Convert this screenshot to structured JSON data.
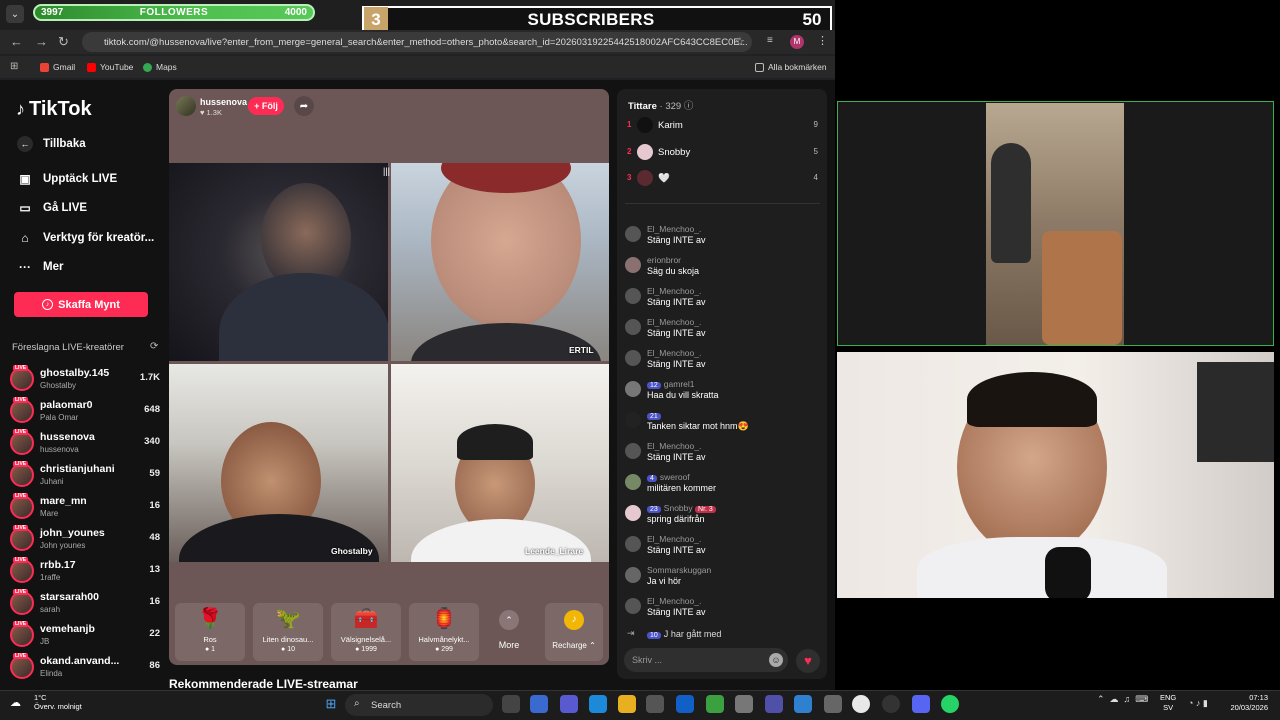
{
  "overlay": {
    "followers": {
      "min": "3997",
      "label": "FOLLOWERS",
      "max": "4000",
      "progress": 0.99
    },
    "subscribers": {
      "rank": "3",
      "label": "SUBSCRIBERS",
      "count": "50"
    }
  },
  "browser": {
    "url": "tiktok.com/@hussenova/live?enter_from_merge=general_search&enter_method=others_photo&search_id=20260319225442518002AFC643CC8EC0E...",
    "bookmarks": [
      "Gmail",
      "YouTube",
      "Maps"
    ],
    "all_bookmarks": "Alla bokmärken",
    "profile_initial": "M"
  },
  "sidebar": {
    "logo": "TikTok",
    "back": "Tillbaka",
    "nav": [
      {
        "label": "Upptäck LIVE",
        "icon": "calendar-icon"
      },
      {
        "label": "Gå LIVE",
        "icon": "camera-icon"
      },
      {
        "label": "Verktyg för kreatör...",
        "icon": "home-icon"
      },
      {
        "label": "Mer",
        "icon": "more-icon"
      }
    ],
    "coins_button": "Skaffa Mynt",
    "suggested_title": "Föreslagna LIVE-kreatörer",
    "creators": [
      {
        "name": "ghostalby.145",
        "sub": "Ghostalby",
        "viewers": "1.7K"
      },
      {
        "name": "palaomar0",
        "sub": "Pala Omar",
        "viewers": "648"
      },
      {
        "name": "hussenova",
        "sub": "hussenova",
        "viewers": "340"
      },
      {
        "name": "christianjuhani",
        "sub": "Juhani",
        "viewers": "59"
      },
      {
        "name": "mare_mn",
        "sub": "Mare",
        "viewers": "16"
      },
      {
        "name": "john_younes",
        "sub": "John younes",
        "viewers": "48"
      },
      {
        "name": "rrbb.17",
        "sub": "1raffe",
        "viewers": "13"
      },
      {
        "name": "starsarah00",
        "sub": "sarah",
        "viewers": "16"
      },
      {
        "name": "vemehanjb",
        "sub": "JB",
        "viewers": "22"
      },
      {
        "name": "okand.anvand...",
        "sub": "Elinda",
        "viewers": "86"
      }
    ],
    "live_badge": "LIVE"
  },
  "player": {
    "host": "hussenova",
    "likes": "1.3K",
    "follow": "+ Följ",
    "cam_tags": {
      "cam2": "ERTIL",
      "cam3": "Ghostalby",
      "cam4": "Leende_Lirare"
    },
    "gifts": [
      {
        "name": "Ros",
        "price": "1",
        "icon": "rose-icon"
      },
      {
        "name": "Liten dinosau...",
        "price": "10",
        "icon": "dinosaur-icon"
      },
      {
        "name": "Välsignelselå...",
        "price": "1999",
        "icon": "chest-icon"
      },
      {
        "name": "Halvmånelykt...",
        "price": "299",
        "icon": "lantern-icon"
      }
    ],
    "more": "More",
    "recharge": "Recharge",
    "recommended": "Rekommenderade LIVE-streamar"
  },
  "chat": {
    "viewers_label": "Tittare",
    "viewers_count": "· 329",
    "top": [
      {
        "rank": "1",
        "name": "Karim",
        "score": "9"
      },
      {
        "rank": "2",
        "name": "Snobby",
        "score": "5"
      },
      {
        "rank": "3",
        "name": "🤍",
        "score": "4"
      }
    ],
    "messages": [
      {
        "user": "El_Menchoo_.",
        "text": "Stäng INTE av",
        "badge": ""
      },
      {
        "user": "erionbror",
        "text": "Säg du skoja",
        "badge": ""
      },
      {
        "user": "El_Menchoo_.",
        "text": "Stäng INTE av",
        "badge": ""
      },
      {
        "user": "El_Menchoo_.",
        "text": "Stäng INTE av",
        "badge": ""
      },
      {
        "user": "El_Menchoo_.",
        "text": "Stäng INTE av",
        "badge": ""
      },
      {
        "user": "gamrel1",
        "text": "Haa du vill skratta",
        "badge": "12"
      },
      {
        "user": "",
        "text": "Tanken siktar mot hnm😍",
        "badge": "21"
      },
      {
        "user": "El_Menchoo_.",
        "text": "Stäng INTE av",
        "badge": ""
      },
      {
        "user": "sweroof",
        "text": "militären kommer",
        "badge": "4"
      },
      {
        "user": "Snobby",
        "text": "spring därifrån",
        "badge": "23",
        "extra": "Nr. 3"
      },
      {
        "user": "El_Menchoo_.",
        "text": "Stäng INTE av",
        "badge": ""
      },
      {
        "user": "Sommarskuggan",
        "text": "Ja vi hör",
        "badge": ""
      },
      {
        "user": "El_Menchoo_.",
        "text": "Stäng INTE av",
        "badge": ""
      }
    ],
    "join": {
      "badge": "10",
      "user": "J",
      "text": "har gått med"
    },
    "input_placeholder": "Skriv ..."
  },
  "taskbar": {
    "weather_temp": "1°C",
    "weather_desc": "Överv. molnigt",
    "search": "Search",
    "lang1": "ENG",
    "lang2": "SV",
    "time": "07:13",
    "date": "20/03/2026"
  }
}
